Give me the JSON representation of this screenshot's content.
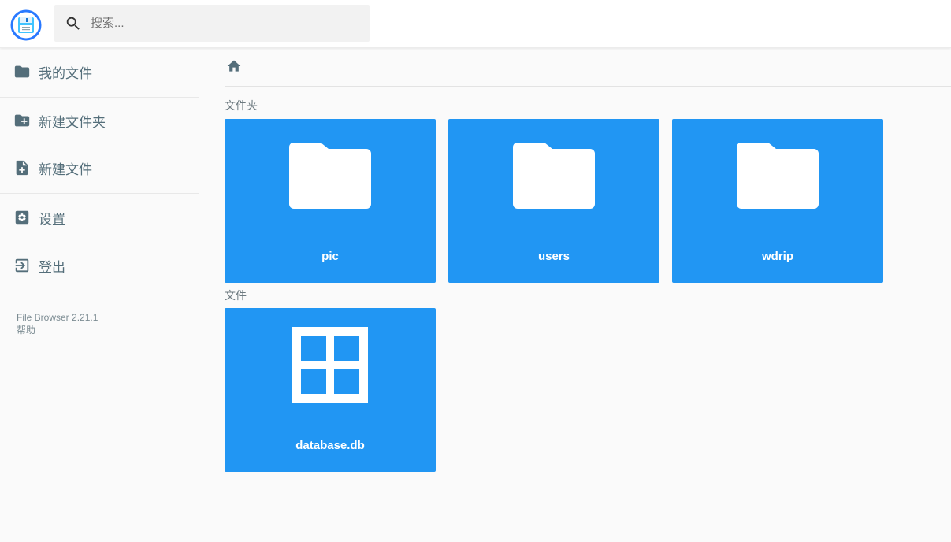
{
  "header": {
    "search_placeholder": "搜索..."
  },
  "sidebar": {
    "items": [
      {
        "label": "我的文件",
        "icon": "folder-icon"
      },
      {
        "label": "新建文件夹",
        "icon": "create-folder-icon"
      },
      {
        "label": "新建文件",
        "icon": "note-add-icon"
      },
      {
        "label": "设置",
        "icon": "settings-icon"
      },
      {
        "label": "登出",
        "icon": "logout-icon"
      }
    ],
    "credits": {
      "version": "File Browser 2.21.1",
      "help": "帮助"
    }
  },
  "main": {
    "folders_title": "文件夹",
    "files_title": "文件",
    "folders": [
      {
        "name": "pic"
      },
      {
        "name": "users"
      },
      {
        "name": "wdrip"
      }
    ],
    "files": [
      {
        "name": "database.db",
        "icon": "file-grid-icon"
      }
    ]
  },
  "colors": {
    "accent": "#2196f3",
    "sidebar_text": "#546e7a",
    "background": "#fafafa"
  }
}
